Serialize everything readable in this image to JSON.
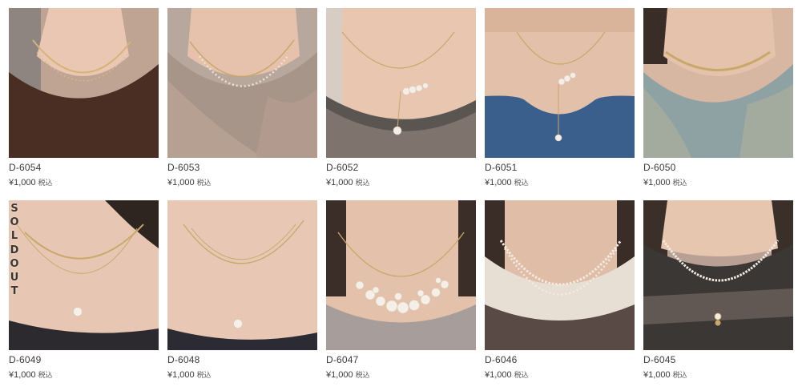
{
  "products": [
    {
      "code": "D-6054",
      "price": "¥1,000",
      "tax": "税込",
      "soldout": false
    },
    {
      "code": "D-6053",
      "price": "¥1,000",
      "tax": "税込",
      "soldout": false
    },
    {
      "code": "D-6052",
      "price": "¥1,000",
      "tax": "税込",
      "soldout": false
    },
    {
      "code": "D-6051",
      "price": "¥1,000",
      "tax": "税込",
      "soldout": false
    },
    {
      "code": "D-6050",
      "price": "¥1,000",
      "tax": "税込",
      "soldout": false
    },
    {
      "code": "D-6049",
      "price": "¥1,000",
      "tax": "税込",
      "soldout": true
    },
    {
      "code": "D-6048",
      "price": "¥1,000",
      "tax": "税込",
      "soldout": false
    },
    {
      "code": "D-6047",
      "price": "¥1,000",
      "tax": "税込",
      "soldout": false
    },
    {
      "code": "D-6046",
      "price": "¥1,000",
      "tax": "税込",
      "soldout": false
    },
    {
      "code": "D-6045",
      "price": "¥1,000",
      "tax": "税込",
      "soldout": false
    }
  ],
  "soldout_letters": [
    "S",
    "O",
    "L",
    "D",
    "O",
    "U",
    "T"
  ],
  "colors": {
    "skin": "#e6c4ae",
    "text": "#3a3a3a",
    "gold": "#c9a86a",
    "pearl": "#f3ece3"
  }
}
